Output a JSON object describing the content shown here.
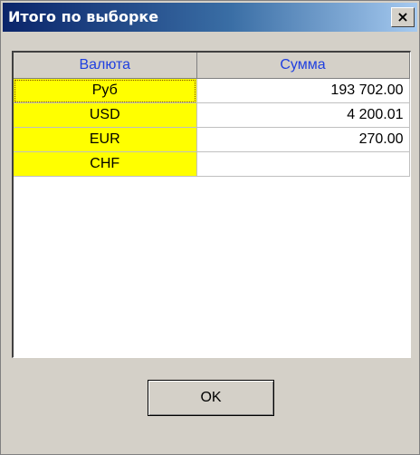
{
  "window": {
    "title": "Итого по выборке",
    "close_label": "×"
  },
  "grid": {
    "columns": [
      "Валюта",
      "Сумма"
    ],
    "rows": [
      {
        "currency": "Руб",
        "amount": "193 702.00"
      },
      {
        "currency": "USD",
        "amount": "4 200.01"
      },
      {
        "currency": "EUR",
        "amount": "270.00"
      },
      {
        "currency": "CHF",
        "amount": ""
      }
    ]
  },
  "buttons": {
    "ok_label": "OK"
  },
  "colors": {
    "currency_cell_bg": "#ffff00",
    "header_text": "#1f3fe0",
    "titlebar_start": "#0a246a",
    "titlebar_end": "#a6caf0"
  }
}
